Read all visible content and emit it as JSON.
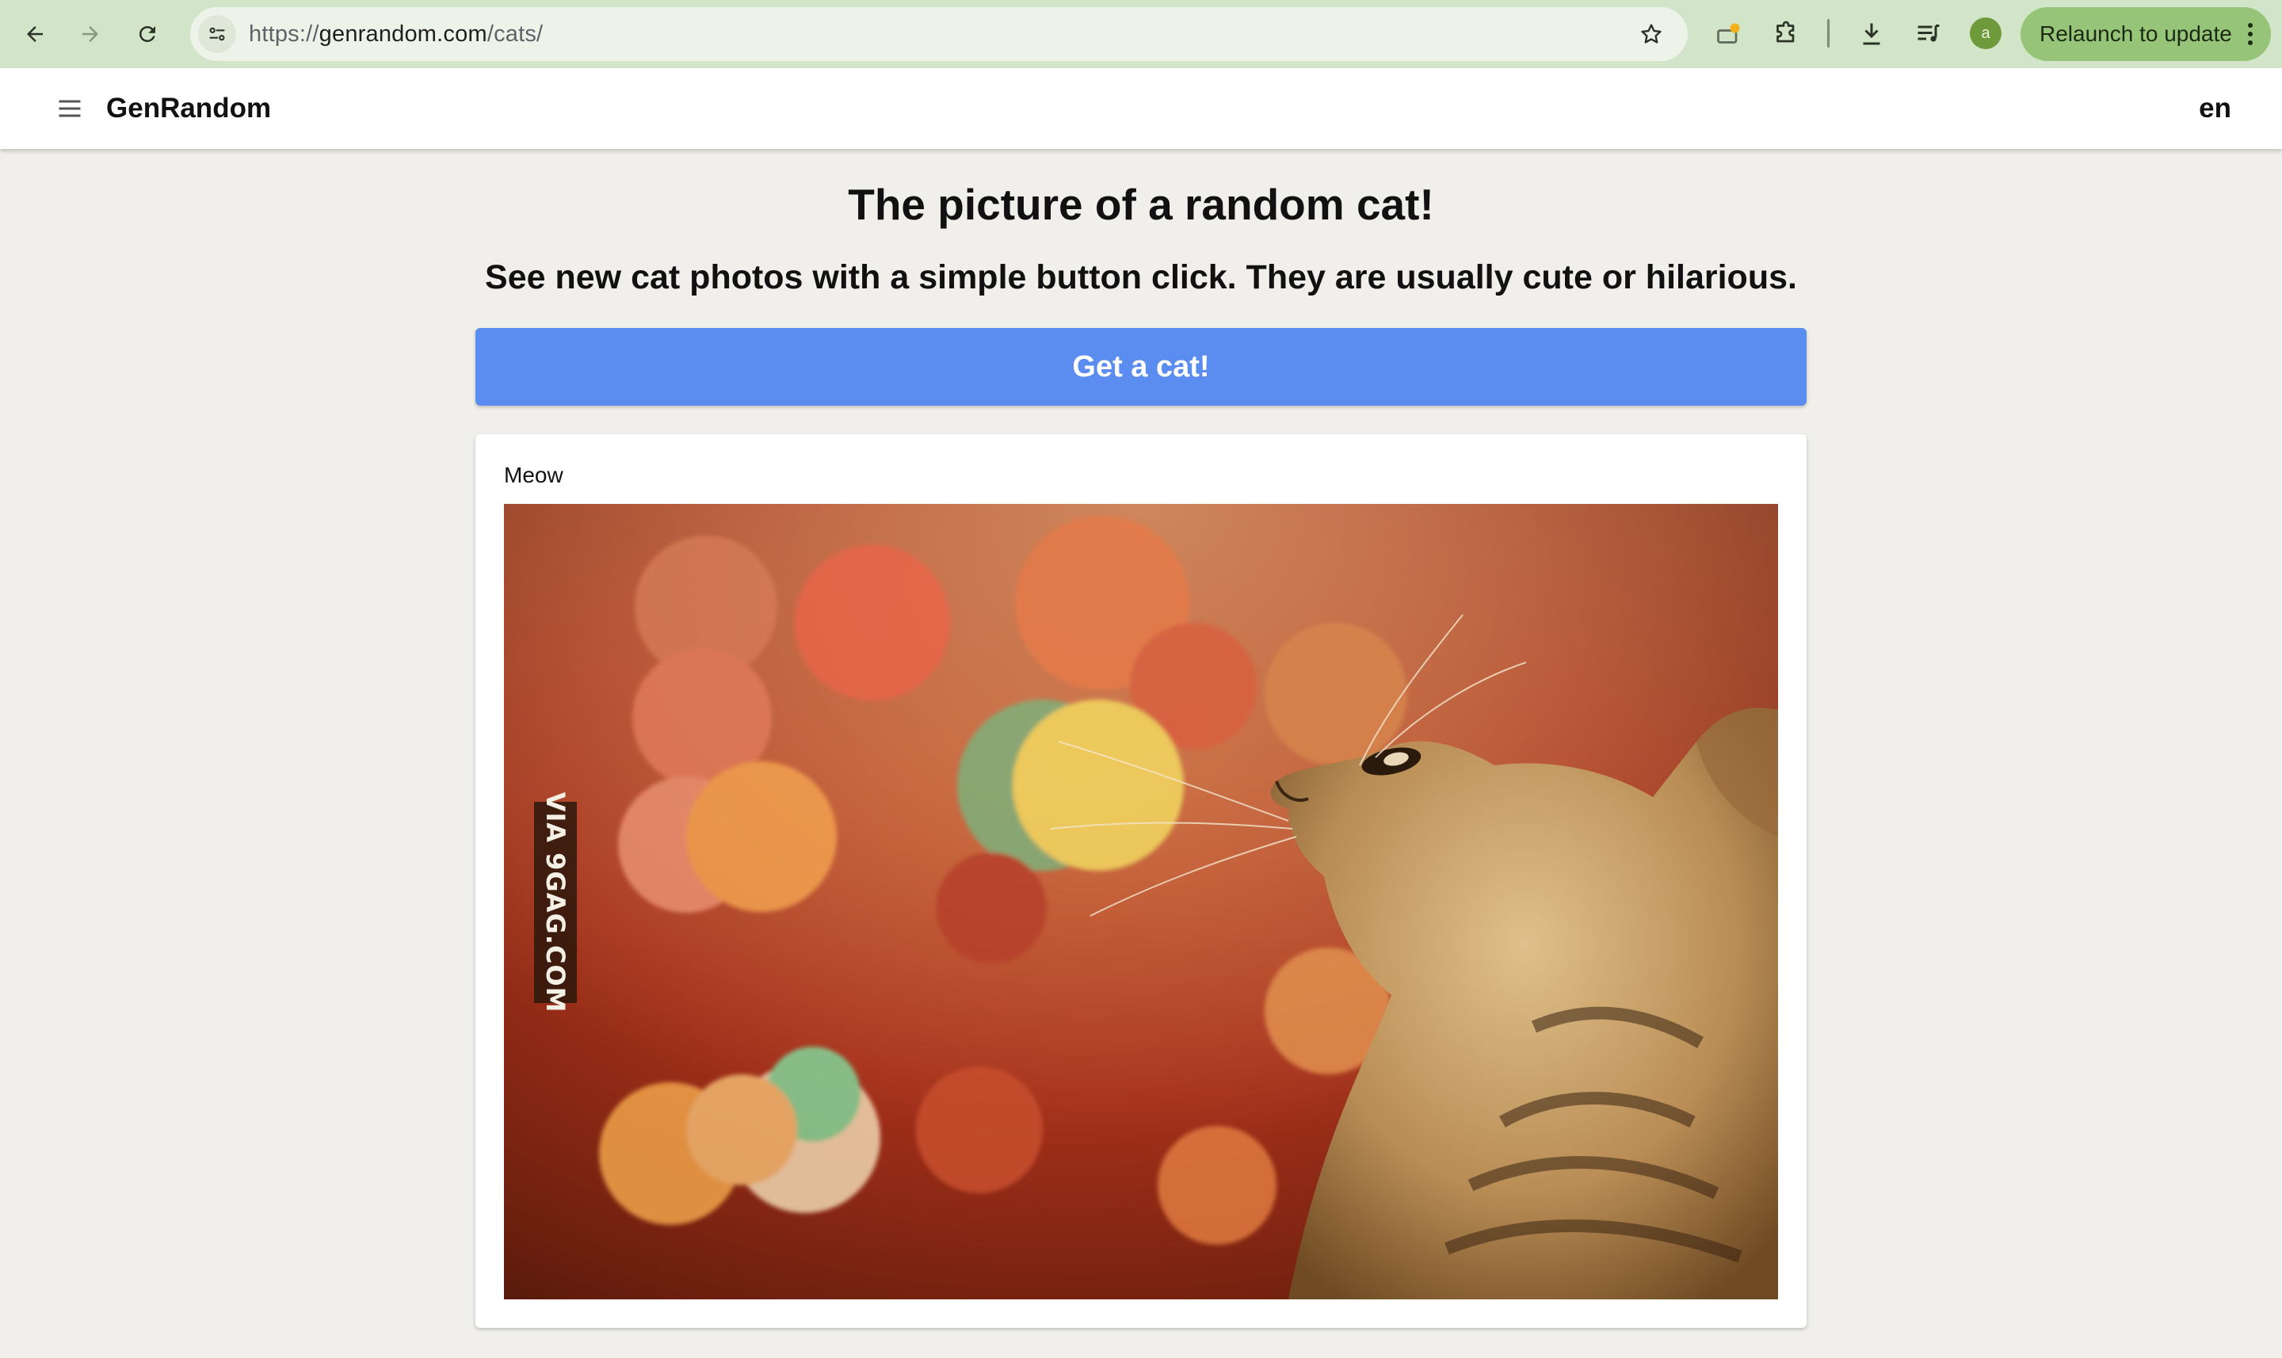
{
  "browser": {
    "url": {
      "scheme": "https://",
      "host": "genrandom.com",
      "path": "/cats/"
    },
    "profile_initial": "a",
    "relaunch_label": "Relaunch to update",
    "icons": [
      "back-arrow-icon",
      "forward-arrow-icon",
      "reload-icon",
      "site-info-icon",
      "star-icon",
      "extension-alert-icon",
      "puzzle-icon",
      "download-icon",
      "media-queue-icon",
      "kebab-menu-icon"
    ]
  },
  "appbar": {
    "brand": "GenRandom",
    "language": "en"
  },
  "main": {
    "title": "The picture of a random cat!",
    "subtitle": "See new cat photos with a simple button click. They are usually cute or hilarious.",
    "button_label": "Get a cat!",
    "card": {
      "label": "Meow",
      "watermark": "VIA 9GAG.COM",
      "image_description_icon": "cat-photo"
    }
  },
  "colors": {
    "chrome_bg": "#d3e5c8",
    "omnibox_bg": "#eef3ea",
    "relaunch_bg": "#96c57a",
    "avatar_bg": "#6f9a3c",
    "page_bg": "#f0efeb",
    "button_bg": "#5b8df0"
  }
}
